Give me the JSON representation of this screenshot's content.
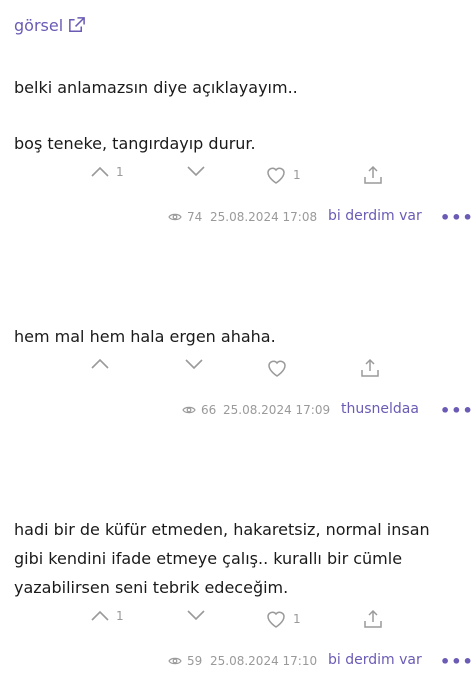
{
  "gorsel_link": {
    "label": "görsel"
  },
  "entries": [
    {
      "lines": [
        "belki anlamazsın diye açıklayayım..",
        "",
        "boş teneke, tangırdayıp durur."
      ],
      "upvotes": "1",
      "likes": "1",
      "views": "74",
      "date": "25.08.2024 17:08",
      "author": "bi derdim var"
    },
    {
      "lines": [
        "hem mal hem hala ergen ahaha."
      ],
      "upvotes": "",
      "likes": "",
      "views": "66",
      "date": "25.08.2024 17:09",
      "author": "thusneldaa"
    },
    {
      "lines": [
        "hadi bir de küfür etmeden, hakaretsiz, normal insan",
        "gibi kendini ifade etmeye çalış.. kurallı bir cümle",
        "yazabilirsen seni tebrik edeceğim."
      ],
      "upvotes": "1",
      "likes": "1",
      "views": "59",
      "date": "25.08.2024 17:10",
      "author": "bi derdim var"
    }
  ],
  "more_label": "•••",
  "icons": [
    "external-link-icon",
    "upvote-icon",
    "downvote-icon",
    "heart-icon",
    "share-icon",
    "eye-icon",
    "more-icon"
  ],
  "colors": {
    "accent": "#6b5bb5",
    "muted": "#9a9a9a",
    "text": "#1a1a1a"
  }
}
